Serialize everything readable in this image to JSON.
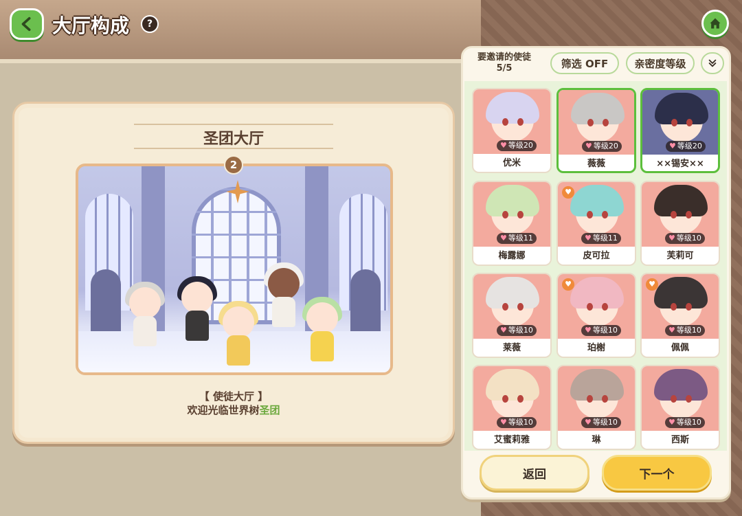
{
  "header": {
    "title": "大厅构成",
    "help_glyph": "?"
  },
  "hall": {
    "title": "圣团大厅",
    "badge": "2",
    "caption_line1": "【 使徒大厅 】",
    "caption_line2_prefix": "欢迎光临世界树",
    "caption_line2_highlight": "圣团"
  },
  "panel": {
    "invite_label": "要邀请的使徒",
    "invite_count": "5/5",
    "filter_label": "筛选 OFF",
    "sort_label": "亲密度等级",
    "sort_toggle": "»",
    "characters": [
      {
        "name": "优米",
        "level": "等级20",
        "selected": false,
        "fav": false,
        "hair": "#d8d4f0",
        "bg": "#f3aa9e"
      },
      {
        "name": "薇薇",
        "level": "等级20",
        "selected": true,
        "fav": false,
        "hair": "#c9c7c5",
        "bg": "#f3aa9e"
      },
      {
        "name": "××锡安××",
        "level": "等级20",
        "selected": true,
        "fav": false,
        "hair": "#2c2f4a",
        "bg": "#6a6fa0"
      },
      {
        "name": "梅露娜",
        "level": "等级11",
        "selected": false,
        "fav": false,
        "hair": "#cfe6b5",
        "bg": "#f3aa9e"
      },
      {
        "name": "皮可拉",
        "level": "等级11",
        "selected": false,
        "fav": true,
        "hair": "#8ed6d2",
        "bg": "#f3aa9e"
      },
      {
        "name": "芙莉可",
        "level": "等级10",
        "selected": false,
        "fav": false,
        "hair": "#3a2e2a",
        "bg": "#f3aa9e"
      },
      {
        "name": "莱薇",
        "level": "等级10",
        "selected": false,
        "fav": false,
        "hair": "#e6e3e1",
        "bg": "#f3aa9e"
      },
      {
        "name": "珀榭",
        "level": "等级10",
        "selected": false,
        "fav": true,
        "hair": "#f1b8c2",
        "bg": "#f3aa9e"
      },
      {
        "name": "佩佩",
        "level": "等级10",
        "selected": false,
        "fav": true,
        "hair": "#3b3535",
        "bg": "#f3aa9e"
      },
      {
        "name": "艾蜜莉雅",
        "level": "等级10",
        "selected": false,
        "fav": false,
        "hair": "#f3e1c4",
        "bg": "#f3aa9e"
      },
      {
        "name": "琳",
        "level": "等级10",
        "selected": false,
        "fav": false,
        "hair": "#b9a49a",
        "bg": "#f3aa9e"
      },
      {
        "name": "西斯",
        "level": "等级10",
        "selected": false,
        "fav": false,
        "hair": "#7c5a84",
        "bg": "#f3aa9e"
      }
    ],
    "back_button": "返回",
    "next_button": "下一个"
  },
  "colors": {
    "accent_green": "#6bbf4e",
    "selected_border": "#5cbf3c",
    "next_yellow": "#f8c842"
  }
}
